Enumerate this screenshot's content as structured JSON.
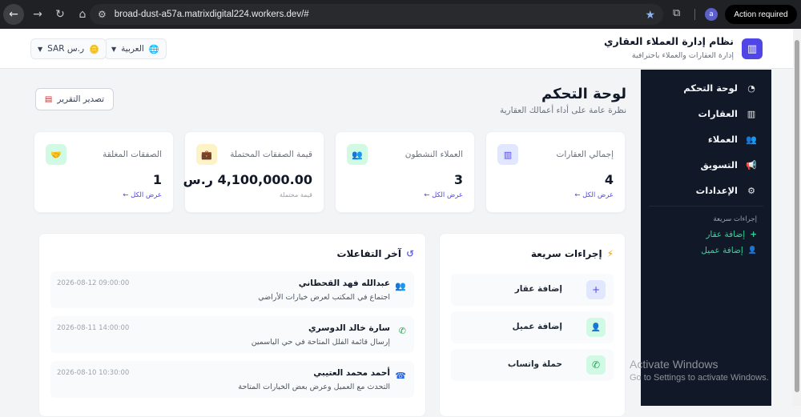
{
  "browser": {
    "url": "broad-dust-a57a.matrixdigital224.workers.dev/#",
    "profile_initial": "a",
    "action_required": "Action required"
  },
  "brand": {
    "title": "نظام إدارة العملاء العقاري",
    "subtitle": "إدارة العقارات والعملاء باحترافية"
  },
  "header_controls": {
    "language": "العربية",
    "currency": "ر.س SAR"
  },
  "sidebar": {
    "items": [
      {
        "label": "لوحة التحكم",
        "icon": "chart-pie-icon",
        "glyph": "◔"
      },
      {
        "label": "العقارات",
        "icon": "building-icon",
        "glyph": "▥"
      },
      {
        "label": "العملاء",
        "icon": "users-icon",
        "glyph": "👥"
      },
      {
        "label": "التسويق",
        "icon": "megaphone-icon",
        "glyph": "📢"
      },
      {
        "label": "الإعدادات",
        "icon": "gear-icon",
        "glyph": "⚙"
      }
    ],
    "quick_heading": "إجراءات سريعة",
    "quick_links": [
      {
        "label": "إضافة عقار",
        "glyph": "+"
      },
      {
        "label": "إضافة عميل",
        "glyph": "👤"
      }
    ]
  },
  "page": {
    "title": "لوحة التحكم",
    "subtitle": "نظرة عامة على أداء أعمالك العقارية",
    "export_label": "تصدير التقرير"
  },
  "stats": [
    {
      "label": "إجمالي العقارات",
      "value": "4",
      "link": "عرض الكل ←",
      "note": "",
      "icon": "building-icon",
      "glyph": "▥",
      "bg": "#e0e7ff",
      "fg": "#4f46e5"
    },
    {
      "label": "العملاء النشطون",
      "value": "3",
      "link": "عرض الكل ←",
      "note": "",
      "icon": "users-icon",
      "glyph": "👥",
      "bg": "#d1fae5",
      "fg": "#059669"
    },
    {
      "label": "قيمة الصفقات المحتملة",
      "value": "4,100,000.00 ر.س",
      "link": "",
      "note": "قيمة محتملة",
      "icon": "briefcase-icon",
      "glyph": "💼",
      "bg": "#fef3c7",
      "fg": "#d97706"
    },
    {
      "label": "الصفقات المغلقة",
      "value": "1",
      "link": "عرض الكل ←",
      "note": "",
      "icon": "handshake-icon",
      "glyph": "🤝",
      "bg": "#d1fae5",
      "fg": "#059669"
    }
  ],
  "quick_actions": {
    "title": "إجراءات سريعة",
    "items": [
      {
        "label": "إضافة عقار",
        "icon": "plus-icon",
        "glyph": "+",
        "bg": "#e0e7ff",
        "fg": "#4f46e5"
      },
      {
        "label": "إضافة عميل",
        "icon": "user-plus-icon",
        "glyph": "👤",
        "bg": "#d1fae5",
        "fg": "#059669"
      },
      {
        "label": "حملة واتساب",
        "icon": "whatsapp-icon",
        "glyph": "✆",
        "bg": "#d1fae5",
        "fg": "#16a34a"
      }
    ]
  },
  "interactions": {
    "title": "آخر التفاعلات",
    "items": [
      {
        "name": "عبدالله فهد القحطاني",
        "desc": "اجتماع في المكتب لعرض خيارات الأراضي",
        "time": "2026-08-12 09:00:00",
        "icon": "meeting-icon",
        "glyph": "👥",
        "color": "#6366f1"
      },
      {
        "name": "سارة خالد الدوسري",
        "desc": "إرسال قائمة الفلل المتاحة في حي الياسمين",
        "time": "2026-08-11 14:00:00",
        "icon": "whatsapp-icon",
        "glyph": "✆",
        "color": "#16a34a"
      },
      {
        "name": "أحمد محمد العتيبي",
        "desc": "التحدث مع العميل وعرض بعض الخيارات المتاحة",
        "time": "2026-08-10 10:30:00",
        "icon": "phone-icon",
        "glyph": "☎",
        "color": "#2563eb"
      }
    ]
  },
  "watermark": {
    "line1": "Activate Windows",
    "line2": "Go to Settings to activate Windows."
  }
}
